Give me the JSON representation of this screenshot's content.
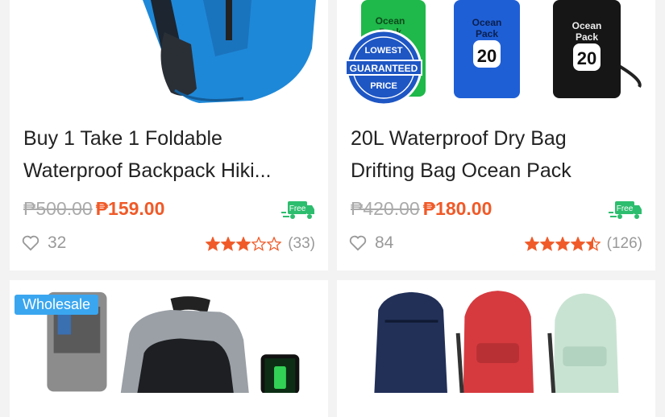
{
  "products": [
    {
      "title_line1": "Buy 1 Take 1 Foldable",
      "title_line2": "Waterproof Backpack Hiki...",
      "old_price": "₱500.00",
      "price": "₱159.00",
      "shipping": "Free",
      "likes": "32",
      "rating_stars": 3,
      "review_count": "(33)"
    },
    {
      "title_line1": "20L Waterproof Dry Bag",
      "title_line2": "Drifting Bag Ocean Pack",
      "old_price": "₱420.00",
      "price": "₱180.00",
      "shipping": "Free",
      "likes": "84",
      "rating_stars": 4.5,
      "review_count": "(126)",
      "image_text": {
        "badge_top": "LOWEST",
        "badge_mid": "GUARANTEED",
        "badge_bottom": "PRICE",
        "bag_brand_1": "Ocean",
        "bag_brand_2": "Pack",
        "bag_size": "20"
      }
    },
    {
      "badge": "Wholesale"
    },
    {}
  ],
  "colors": {
    "price": "#f05a28",
    "star": "#f05a28",
    "free_badge": "#2dbd6e",
    "wholesale_badge": "#3aa6f0"
  }
}
